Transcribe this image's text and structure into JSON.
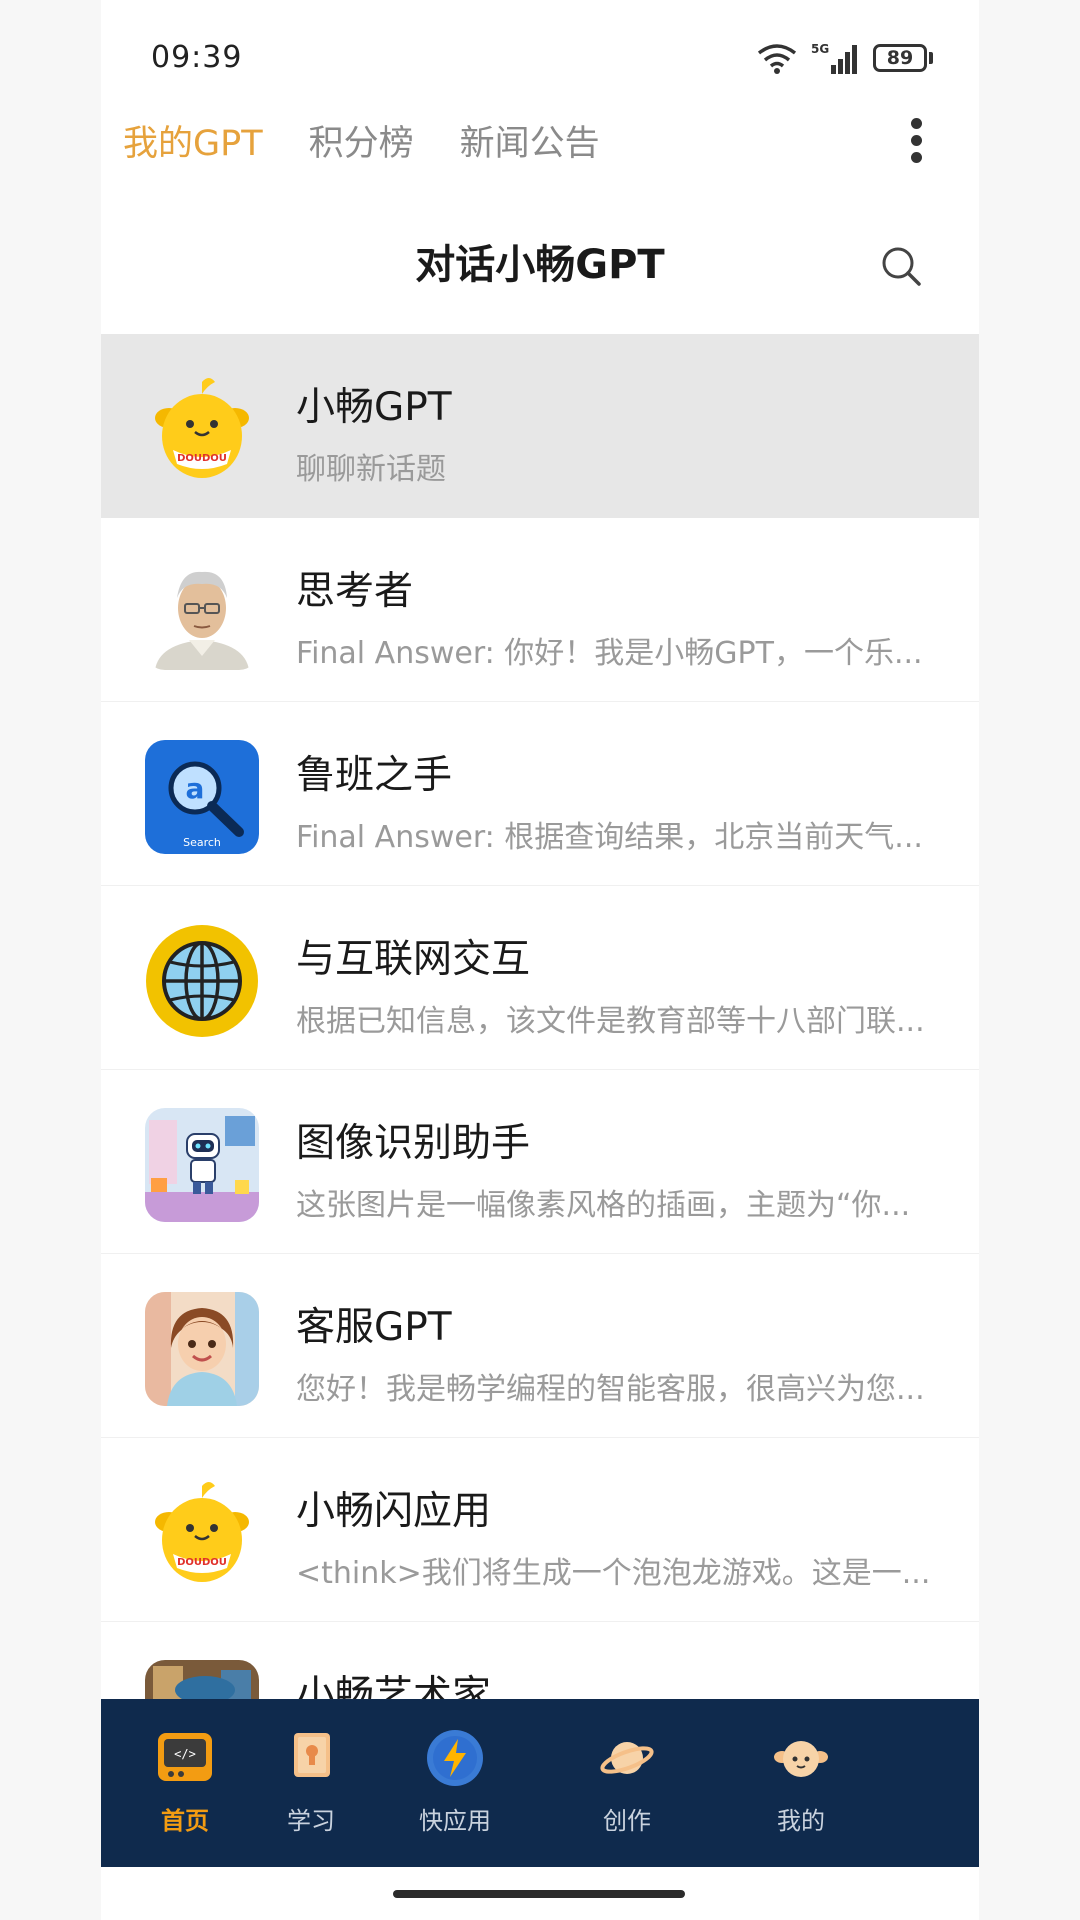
{
  "status_bar": {
    "time": "09:39",
    "battery": "89",
    "wifi_icon": "wifi-icon",
    "signal_icon": "signal-5g-icon",
    "signal_label": "5G"
  },
  "top_tabs": [
    {
      "label": "我的GPT",
      "active": true
    },
    {
      "label": "积分榜",
      "active": false
    },
    {
      "label": "新闻公告",
      "active": false
    }
  ],
  "header": {
    "title": "对话小畅GPT",
    "search_icon": "search-icon",
    "more_icon": "more-vertical-icon"
  },
  "chats": [
    {
      "name": "小畅GPT",
      "preview": "聊聊新话题",
      "avatar": "doudou-mascot-avatar",
      "avatar_text": "DOUDOU",
      "selected": true
    },
    {
      "name": "思考者",
      "preview": "Final Answer: 你好！我是小畅GPT，一个乐...",
      "avatar": "thinker-portrait-avatar",
      "selected": false
    },
    {
      "name": "鲁班之手",
      "preview": "Final Answer: 根据查询结果，北京当前天气...",
      "avatar": "search-magnifier-avatar",
      "avatar_text": "Search",
      "selected": false
    },
    {
      "name": "与互联网交互",
      "preview": "根据已知信息，该文件是教育部等十八部门联...",
      "avatar": "globe-avatar",
      "selected": false
    },
    {
      "name": "图像识别助手",
      "preview": "这张图片是一幅像素风格的插画，主题为“你...",
      "avatar": "robot-room-avatar",
      "selected": false
    },
    {
      "name": "客服GPT",
      "preview": "您好！我是畅学编程的智能客服，很高兴为您...",
      "avatar": "service-girl-avatar",
      "selected": false
    },
    {
      "name": "小畅闪应用",
      "preview": "<think>我们将生成一个泡泡龙游戏。这是一...",
      "avatar": "doudou-mascot-avatar",
      "avatar_text": "DOUDOU",
      "selected": false
    },
    {
      "name": "小畅艺术家",
      "preview": "",
      "avatar": "artist-avatar",
      "selected": false
    }
  ],
  "bottom_nav": [
    {
      "label": "首页",
      "icon": "code-screen-icon",
      "active": true
    },
    {
      "label": "学习",
      "icon": "book-icon",
      "active": false
    },
    {
      "label": "快应用",
      "icon": "lightning-icon",
      "active": false
    },
    {
      "label": "创作",
      "icon": "planet-icon",
      "active": false
    },
    {
      "label": "我的",
      "icon": "profile-avatar-icon",
      "active": false
    }
  ],
  "colors": {
    "accent": "#e6a23c",
    "nav_bg": "#0f2a4d",
    "nav_active": "#f39c12",
    "selected_row": "#e7e7e7"
  }
}
